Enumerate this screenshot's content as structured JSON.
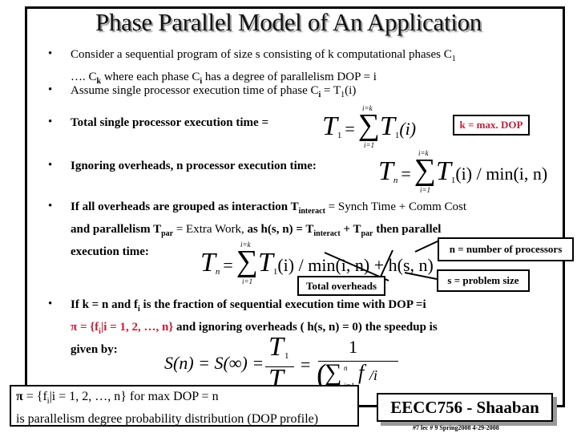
{
  "title": "Phase Parallel Model of An Application",
  "bullets": {
    "b1_line1": "Consider a sequential program of size s consisting of  k computational phases  C",
    "b1_sub1": "1",
    "b1_line2a": "…. C",
    "b1_subk": "k",
    "b1_line2b": "  where each phase C",
    "b1_subi": "i",
    "b1_line2c": "  has a degree of parallelism DOP = i",
    "b2a": "Assume single processor execution time of phase  C",
    "b2_subi": "i",
    "b2b": "  = T",
    "b2_sub1": "1",
    "b2c": "(i)",
    "b3": "Total single processor execution time =",
    "b4": "Ignoring overheads, n processor execution time:",
    "b5_l1a": "If all overheads are grouped as interaction T",
    "b5_sub_interact": "interact",
    "b5_l1b": " = Synch Time + Comm Cost",
    "b5_l2a": "and parallelism T",
    "b5_sub_par": "par",
    "b5_l2b": " = Extra Work,",
    "b5_l2c": "  as  h(s, n)  = T",
    "b5_l2d": " + T",
    "b5_l2e": "  then parallel",
    "b5_l3": "execution time:",
    "b6_l1a": "If  k = n and  f",
    "b6_sub": "i",
    "b6_l1b": "  is the fraction of sequential execution time with DOP =i",
    "b6_l2_red": "π = {f",
    "b6_l2_red2": "|i = 1, 2, …, n}",
    "b6_l2b": "  and ignoring overheads ( h(s, n)  =  0) the speedup is",
    "b6_l3": "given by:"
  },
  "formulas": {
    "t1_lhs": "T",
    "t1_sub": "1",
    "eq": "=",
    "sigma": "∑",
    "upper_k": "i=k",
    "lower_1": "i=1",
    "t1_term": "T",
    "t1_arg": "(i)",
    "tn_lhs": "T",
    "tn_sub": "n",
    "min_term": "(i) / min(i, n)",
    "overhead_term": " + h(s, n)",
    "speedup_lhs": "S(n) = S(∞) =",
    "speedup_num": "T",
    "speedup_den": "T",
    "one": "1",
    "sum_upper": "n",
    "sum_lower": "i=1",
    "f_term": "f",
    "f_over_i": "/i"
  },
  "callouts": {
    "k_max": "k = max. DOP",
    "n_procs": "n = number of processors",
    "total_overheads": "Total overheads",
    "s_size": "s = problem size"
  },
  "note": {
    "line1a": "π",
    "line1b": " = {f",
    "line1c": "|i = 1, 2, …, n}   for max DOP = n",
    "line2": "is parallelism degree probability distribution (DOP profile)"
  },
  "brand": "EECC756 - Shaaban",
  "footer": "#7  lec # 9   Spring2008  4-29-2008",
  "colors": {
    "accent_red": "#c0203a",
    "shadow": "#999999"
  }
}
